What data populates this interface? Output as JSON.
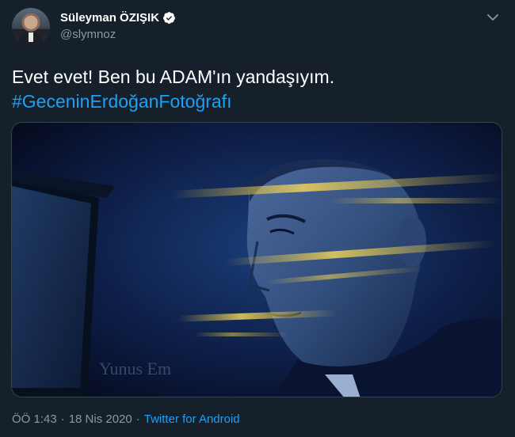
{
  "tweet": {
    "author": {
      "display_name": "Süleyman ÖZIŞIK",
      "handle": "@slymnoz",
      "verified": true
    },
    "text": "Evet evet! Ben bu ADAM'ın yandaşıyım.",
    "hashtag": "#GeceninErdoğanFotoğrafı",
    "media": {
      "watermark": "Yunus Em"
    },
    "meta": {
      "time": "ÖÖ 1:43",
      "separator1": "·",
      "date": "18 Nis 2020",
      "separator2": "·",
      "source": "Twitter for Android"
    }
  },
  "icons": {
    "verified": "verified-badge-icon",
    "more": "chevron-down-icon"
  },
  "colors": {
    "background": "#15202b",
    "link": "#1da1f2",
    "secondary_text": "#8899a6",
    "border": "#38444d"
  }
}
